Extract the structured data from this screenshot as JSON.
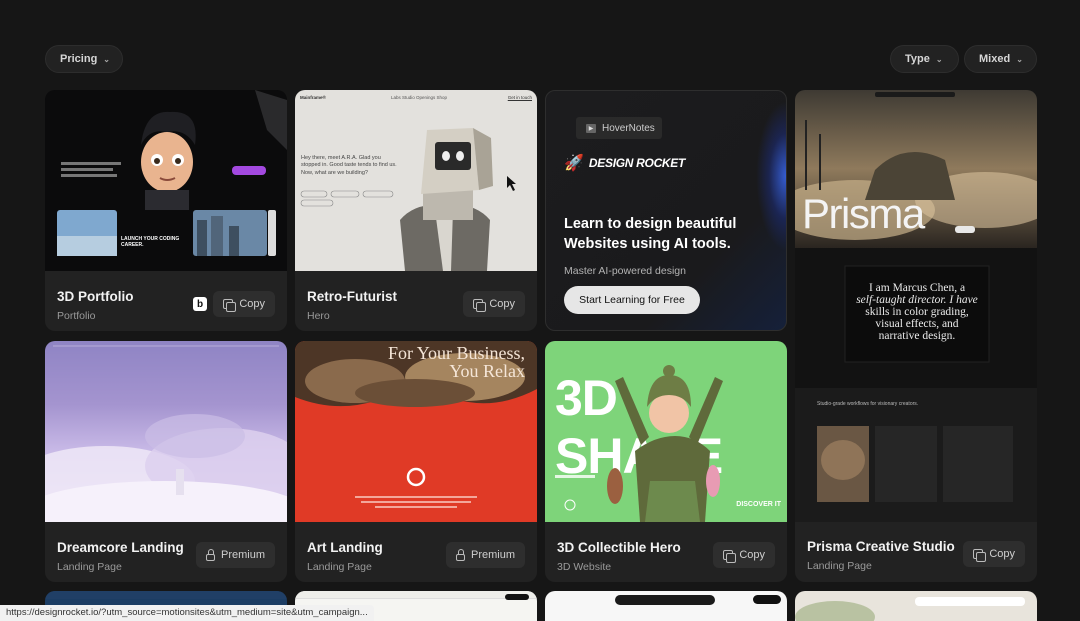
{
  "filters": {
    "pricing": "Pricing",
    "type": "Type",
    "mixed": "Mixed"
  },
  "cards": [
    {
      "title": "3D Portfolio",
      "subtitle": "Portfolio",
      "action": "Copy",
      "badge": "b"
    },
    {
      "title": "Retro-Futurist",
      "subtitle": "Hero",
      "action": "Copy"
    },
    {
      "title": "Dreamcore Landing",
      "subtitle": "Landing Page",
      "action": "Premium"
    },
    {
      "title": "Art Landing",
      "subtitle": "Landing Page",
      "action": "Premium"
    },
    {
      "title": "3D Collectible Hero",
      "subtitle": "3D Website",
      "action": "Copy"
    },
    {
      "title": "Prisma Creative Studio",
      "subtitle": "Landing Page",
      "action": "Copy"
    }
  ],
  "ad": {
    "pill": "HoverNotes",
    "brand": "DESIGN ROCKET",
    "headline": "Learn to design beautiful Websites using AI tools.",
    "sub": "Master AI-powered design",
    "cta": "Start Learning for Free"
  },
  "thumbs": {
    "portfolio_cta": "LAUNCH YOUR CODING CAREER.",
    "retro_nav_left": "Mainframe®",
    "retro_nav_mid": "Labs  Studio  Openings  Shop",
    "retro_nav_right": "Get in touch",
    "retro_text": "Hey there, meet A.R.A. Glad you stopped in. Good taste tends to find us. Now, what are we building?",
    "art_headline_1": "For Your Business,",
    "art_headline_2": "You Relax",
    "collect_title": "3D SHAPE",
    "collect_cta": "DISCOVER IT",
    "prisma_logo": "Prisma",
    "prisma_bio_1": "I am Marcus Chen, a",
    "prisma_bio_2": "self-taught director. I have",
    "prisma_bio_3": "skills in color grading,",
    "prisma_bio_4": "visual effects, and",
    "prisma_bio_5": "narrative design.",
    "prisma_strip": "Studio-grade workflows for visionary creators."
  },
  "status_url": "https://designrocket.io/?utm_source=motionsites&utm_medium=site&utm_campaign..."
}
